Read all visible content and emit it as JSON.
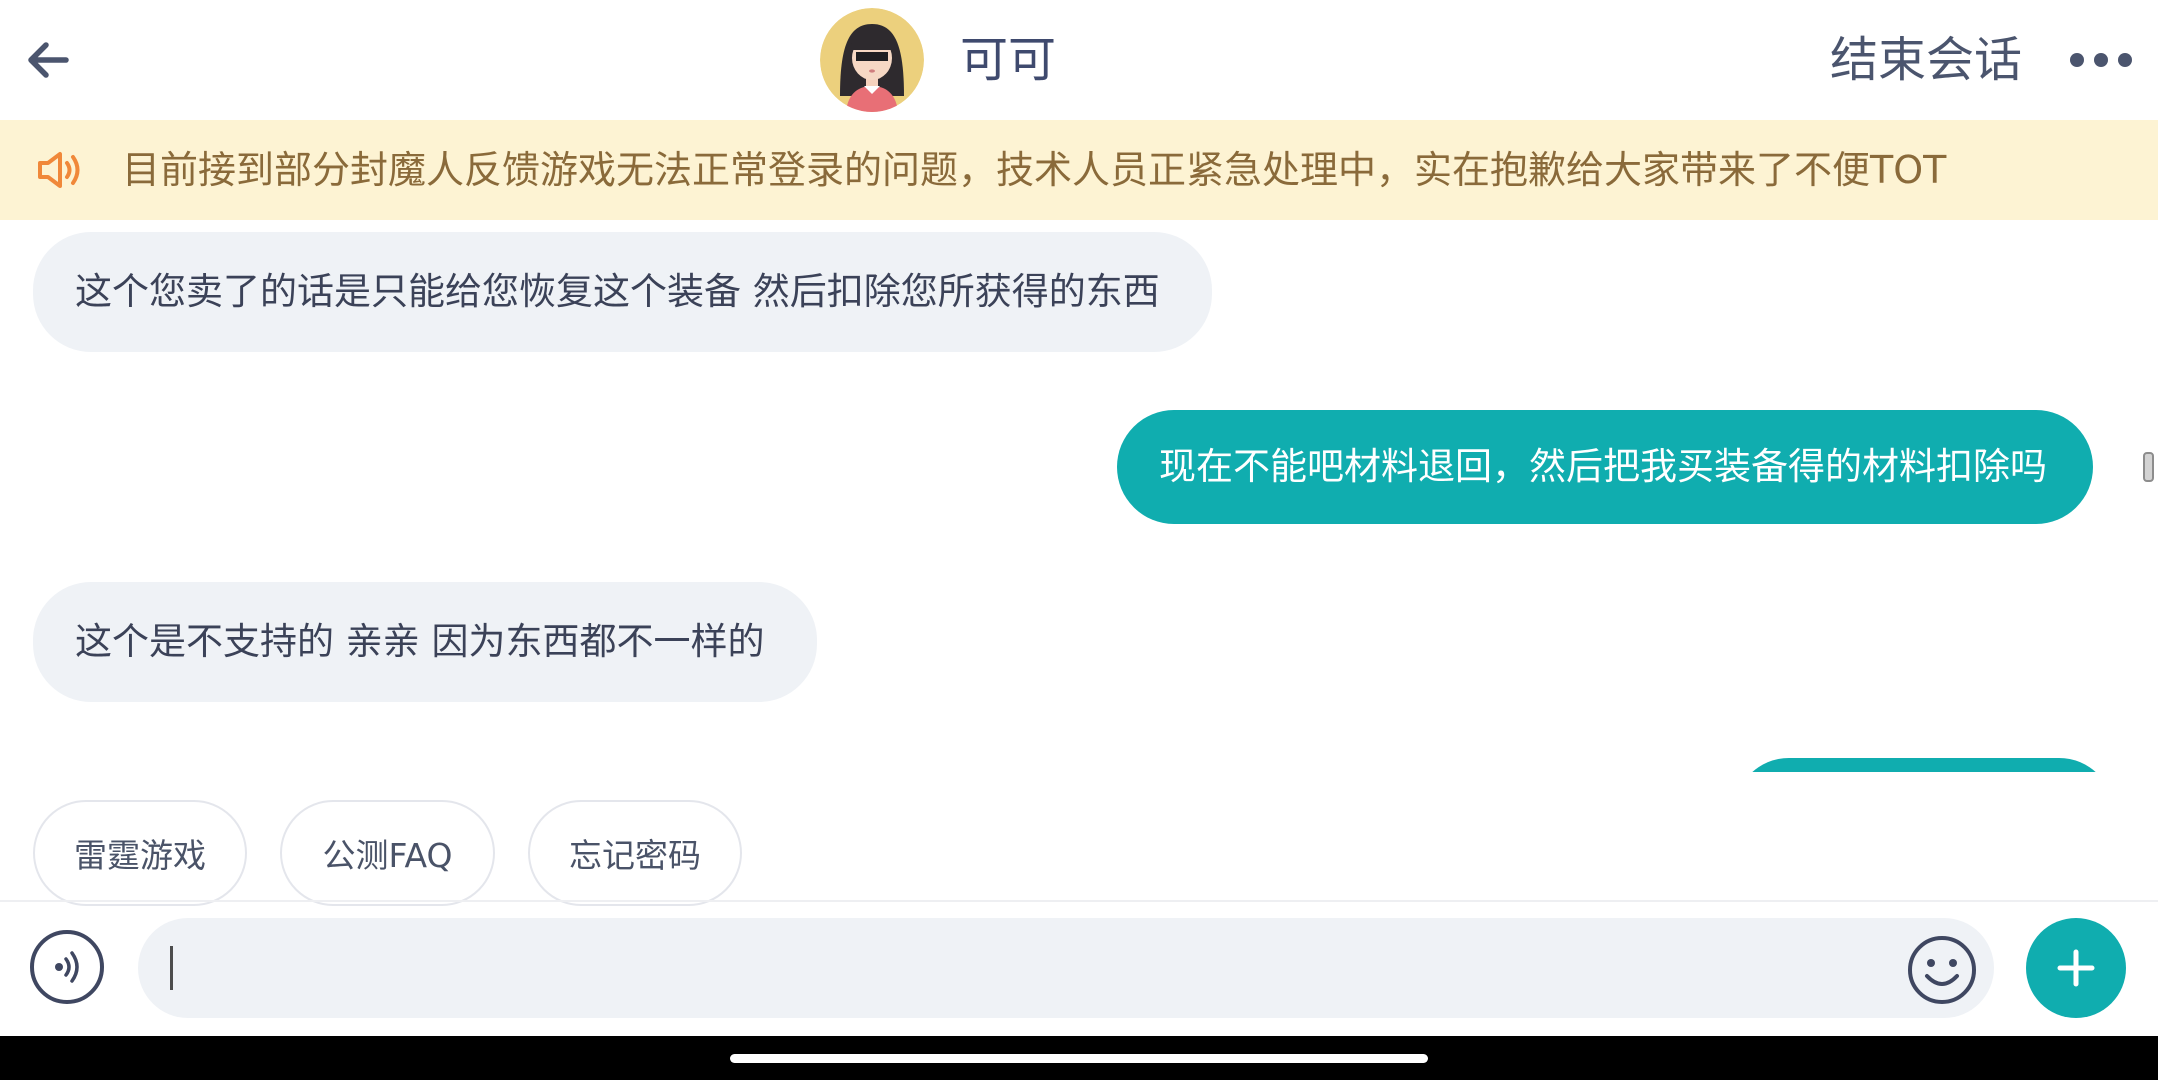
{
  "header": {
    "back_icon": "arrow-left-icon",
    "agent_name": "可可",
    "end_chat_label": "结束会话",
    "more_icon": "ellipsis-icon"
  },
  "notice": {
    "icon": "speaker-icon",
    "text": "目前接到部分封魔人反馈游戏无法正常登录的问题，技术人员正紧急处理中，实在抱歉给大家带来了不便TOT"
  },
  "messages": [
    {
      "from": "agent",
      "text": "这个您卖了的话是只能给您恢复这个装备 然后扣除您所获得的东西"
    },
    {
      "from": "user",
      "text": "现在不能吧材料退回，然后把我买装备得的材料扣除吗"
    },
    {
      "from": "agent",
      "text": "这个是不支持的 亲亲 因为东西都不一样的"
    },
    {
      "from": "user",
      "text": ""
    }
  ],
  "quick_replies": [
    "雷霆游戏",
    "公测FAQ",
    "忘记密码"
  ],
  "composer": {
    "voice_icon": "voice-input-icon",
    "input_value": "",
    "emoji_icon": "smiley-icon",
    "plus_icon": "plus-icon"
  },
  "colors": {
    "accent": "#10adaf",
    "notice_bg": "#fdf3d3",
    "notice_text": "#8a6a3a",
    "bubble_in": "#eff2f6",
    "title_text": "#3f4a6e"
  }
}
